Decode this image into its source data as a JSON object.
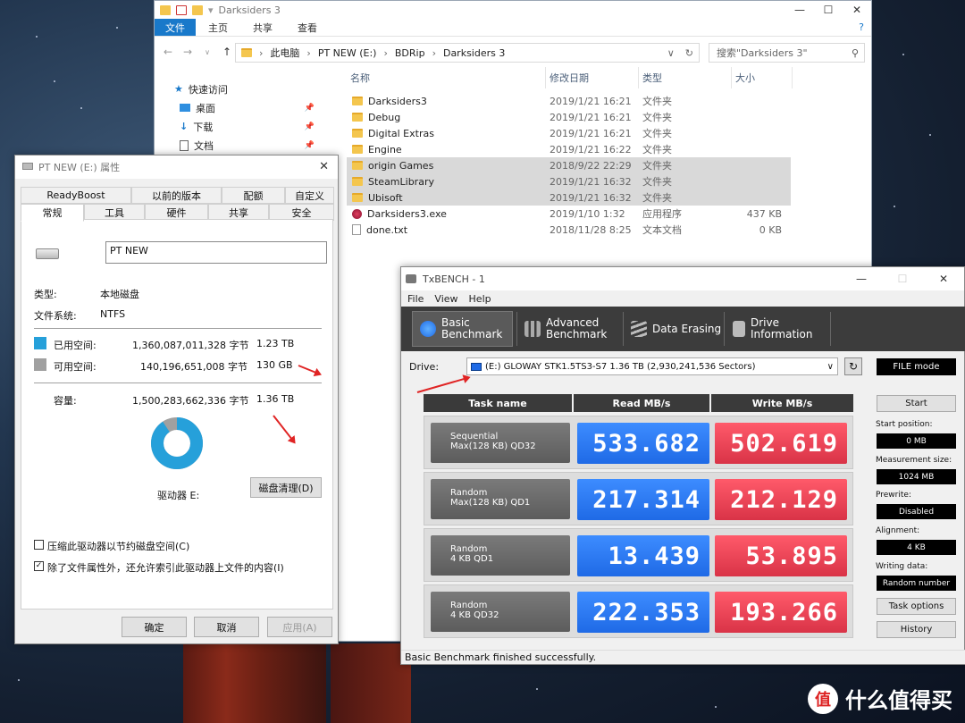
{
  "explorer": {
    "title": "Darksiders 3",
    "ribbon_tabs": [
      "文件",
      "主页",
      "共享",
      "查看"
    ],
    "breadcrumb": [
      "此电脑",
      "PT NEW (E:)",
      "BDRip",
      "Darksiders 3"
    ],
    "search_placeholder": "搜索\"Darksiders 3\"",
    "nav_tree": [
      {
        "label": "快速访问",
        "icon": "star-icon"
      },
      {
        "label": "桌面",
        "icon": "desktop-icon"
      },
      {
        "label": "下载",
        "icon": "download-icon"
      },
      {
        "label": "文档",
        "icon": "document-icon"
      }
    ],
    "columns": [
      "名称",
      "修改日期",
      "类型",
      "大小"
    ],
    "files": [
      {
        "name": "Darksiders3",
        "date": "2019/1/21 16:21",
        "type": "文件夹",
        "size": "",
        "kind": "folder",
        "selected": false
      },
      {
        "name": "Debug",
        "date": "2019/1/21 16:21",
        "type": "文件夹",
        "size": "",
        "kind": "folder",
        "selected": false
      },
      {
        "name": "Digital Extras",
        "date": "2019/1/21 16:21",
        "type": "文件夹",
        "size": "",
        "kind": "folder",
        "selected": false
      },
      {
        "name": "Engine",
        "date": "2019/1/21 16:22",
        "type": "文件夹",
        "size": "",
        "kind": "folder",
        "selected": false
      },
      {
        "name": "origin Games",
        "date": "2018/9/22 22:29",
        "type": "文件夹",
        "size": "",
        "kind": "folder",
        "selected": true
      },
      {
        "name": "SteamLibrary",
        "date": "2019/1/21 16:32",
        "type": "文件夹",
        "size": "",
        "kind": "folder",
        "selected": true
      },
      {
        "name": "Ubisoft",
        "date": "2019/1/21 16:32",
        "type": "文件夹",
        "size": "",
        "kind": "folder",
        "selected": true
      },
      {
        "name": "Darksiders3.exe",
        "date": "2019/1/10 1:32",
        "type": "应用程序",
        "size": "437 KB",
        "kind": "exe",
        "selected": false
      },
      {
        "name": "done.txt",
        "date": "2018/11/28 8:25",
        "type": "文本文档",
        "size": "0 KB",
        "kind": "txt",
        "selected": false
      }
    ]
  },
  "props": {
    "title": "PT NEW (E:) 属性",
    "tabs_row1": [
      "ReadyBoost",
      "以前的版本",
      "配额",
      "自定义"
    ],
    "tabs_row2": [
      "常规",
      "工具",
      "硬件",
      "共享",
      "安全"
    ],
    "drive_name": "PT NEW",
    "type_label": "类型:",
    "type_value": "本地磁盘",
    "fs_label": "文件系统:",
    "fs_value": "NTFS",
    "used_label": "已用空间:",
    "used_bytes": "1,360,087,011,328 字节",
    "used_size": "1.23 TB",
    "free_label": "可用空间:",
    "free_bytes": "140,196,651,008 字节",
    "free_size": "130 GB",
    "cap_label": "容量:",
    "cap_bytes": "1,500,283,662,336 字节",
    "cap_size": "1.36 TB",
    "used_fraction": 0.9066,
    "used_color": "#26a0da",
    "free_color": "#a0a0a0",
    "drive_label": "驱动器 E:",
    "cleanup_btn": "磁盘清理(D)",
    "compress_chk": "压缩此驱动器以节约磁盘空间(C)",
    "index_chk": "除了文件属性外，还允许索引此驱动器上文件的内容(I)",
    "ok_btn": "确定",
    "cancel_btn": "取消",
    "apply_btn": "应用(A)"
  },
  "tx": {
    "title": "TxBENCH - 1",
    "menu": [
      "File",
      "View",
      "Help"
    ],
    "tools": [
      {
        "label1": "Basic",
        "label2": "Benchmark",
        "icon": "benchmark-icon"
      },
      {
        "label1": "Advanced",
        "label2": "Benchmark",
        "icon": "bar-chart-icon"
      },
      {
        "label1": "Data Erasing",
        "label2": "",
        "icon": "eraser-icon"
      },
      {
        "label1": "Drive",
        "label2": "Information",
        "icon": "drive-info-icon"
      }
    ],
    "drive_label": "Drive:",
    "drive_value": "(E:) GLOWAY STK1.5TS3-S7  1.36 TB (2,930,241,536 Sectors)",
    "mode": "FILE mode",
    "headers": [
      "Task name",
      "Read MB/s",
      "Write MB/s"
    ],
    "rows": [
      {
        "l1": "Sequential",
        "l2": "Max(128 KB) QD32",
        "read": "533.682",
        "write": "502.619"
      },
      {
        "l1": "Random",
        "l2": "Max(128 KB) QD1",
        "read": "217.314",
        "write": "212.129"
      },
      {
        "l1": "Random",
        "l2": "4 KB QD1",
        "read": "13.439",
        "write": "53.895"
      },
      {
        "l1": "Random",
        "l2": "4 KB QD32",
        "read": "222.353",
        "write": "193.266"
      }
    ],
    "start_btn": "Start",
    "start_pos_label": "Start position:",
    "start_pos": "0 MB",
    "meas_label": "Measurement size:",
    "meas": "1024 MB",
    "prewrite_label": "Prewrite:",
    "prewrite": "Disabled",
    "align_label": "Alignment:",
    "align": "4 KB",
    "writing_label": "Writing data:",
    "writing": "Random number",
    "task_opts_btn": "Task options",
    "history_btn": "History",
    "status": "Basic Benchmark finished successfully."
  },
  "watermark": {
    "text": "什么值得买",
    "logo": "值"
  }
}
